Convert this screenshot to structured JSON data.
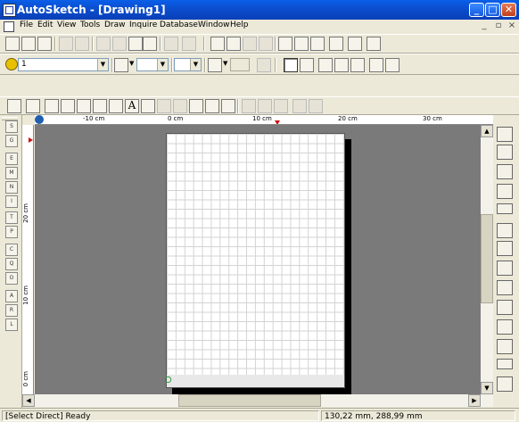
{
  "window": {
    "title": "AutoSketch - [Drawing1]",
    "minimize": "_",
    "maximize": "□",
    "close": "✕"
  },
  "menu": {
    "items": [
      "File",
      "Edit",
      "View",
      "Tools",
      "Draw",
      "Inquire",
      "Database",
      "Window",
      "Help"
    ],
    "doc_controls": [
      "_",
      "▫",
      "×"
    ]
  },
  "layer_toolbar": {
    "layer_value": "1",
    "line_width_value": "",
    "line_type_value": ""
  },
  "rulers": {
    "horizontal": [
      "-10 cm",
      "0 cm",
      "10 cm",
      "20 cm",
      "30 cm"
    ],
    "vertical": [
      "20 cm",
      "10 cm",
      "0 cm"
    ]
  },
  "status": {
    "message": "[Select Direct] Ready",
    "coords": "130,22 mm, 288,99 mm"
  },
  "colors": {
    "titlebar": "#0a4fd0",
    "workspace": "#7a7a7a",
    "paper": "#ffffff",
    "grid": "#d3d3d3",
    "origin_marker": "#d01010"
  }
}
